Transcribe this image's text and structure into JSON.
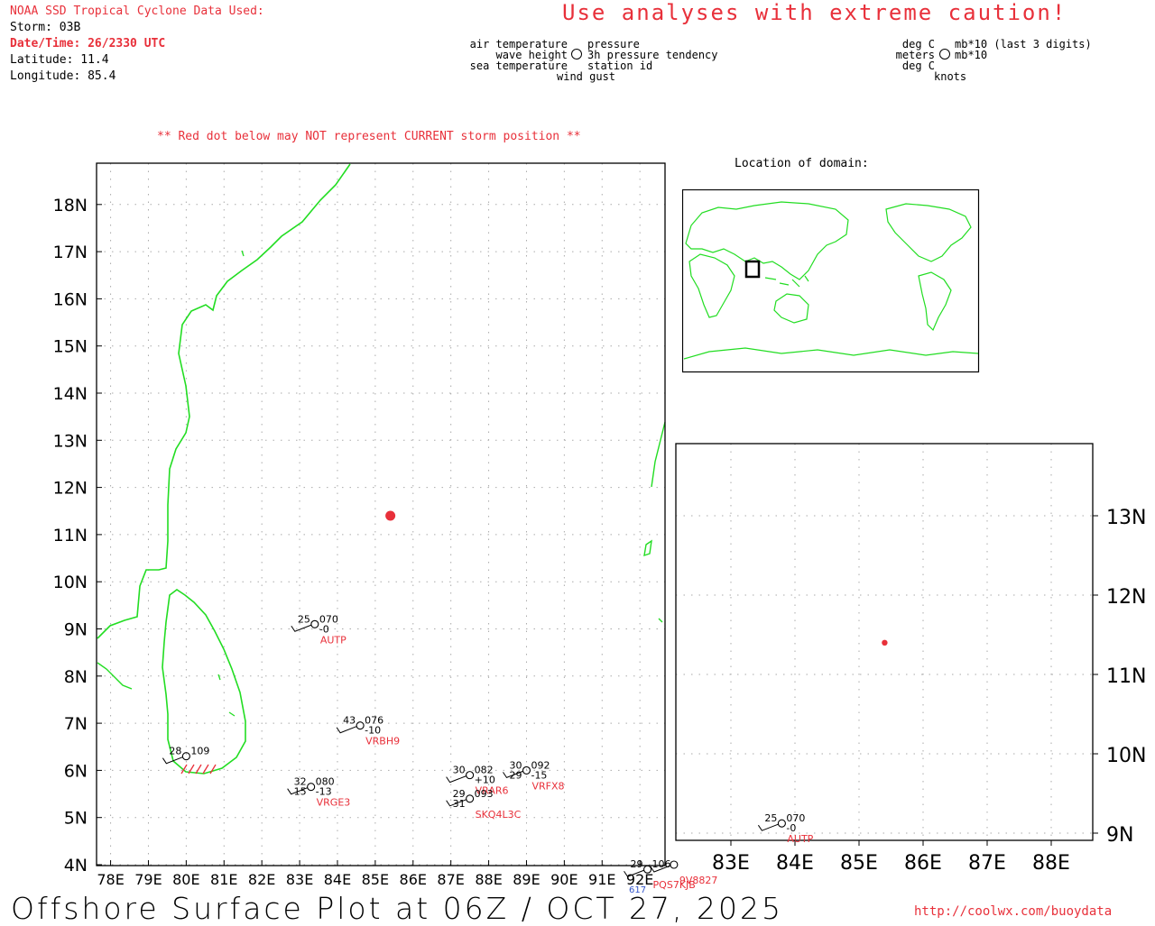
{
  "header": {
    "source": "NOAA SSD Tropical Cyclone Data Used:",
    "storm": "Storm: 03B",
    "datetime": "Date/Time: 26/2330 UTC",
    "latitude": "Latitude: 11.4",
    "longitude": "Longitude: 85.4"
  },
  "caution": "Use analyses with extreme caution!",
  "legend": {
    "left": [
      "air temperature",
      "wave height",
      "sea temperature"
    ],
    "right": [
      "pressure",
      "3h pressure tendency",
      "station id"
    ],
    "bottom": "wind gust",
    "units_left": [
      "deg C",
      "meters",
      "deg C"
    ],
    "units_right": [
      "mb*10 (last 3 digits)",
      "mb*10"
    ],
    "units_bottom": "knots"
  },
  "warning": "** Red dot below may NOT represent CURRENT storm position **",
  "location_title": "Location of domain:",
  "main_map": {
    "lat_labels": [
      "18N",
      "17N",
      "16N",
      "15N",
      "14N",
      "13N",
      "12N",
      "11N",
      "10N",
      "9N",
      "8N",
      "7N",
      "6N",
      "5N",
      "4N"
    ],
    "lon_labels": [
      "78E",
      "79E",
      "80E",
      "81E",
      "82E",
      "83E",
      "84E",
      "85E",
      "86E",
      "87E",
      "88E",
      "89E",
      "90E",
      "91E",
      "92E"
    ],
    "storm_position": {
      "lat": 11.4,
      "lon": 85.4
    },
    "stations": [
      {
        "id": "AUTP",
        "lat": 9.1,
        "lon": 83.4,
        "air": "25",
        "pressure": "070",
        "tendency": "-0"
      },
      {
        "id": "VRBH9",
        "lat": 6.95,
        "lon": 84.6,
        "air": "43",
        "pressure": "076",
        "tendency": "-10"
      },
      {
        "id": "",
        "lat": 6.3,
        "lon": 80.0,
        "air": "28",
        "pressure": "109",
        "tendency": ""
      },
      {
        "id": "VRGE3",
        "lat": 5.65,
        "lon": 83.3,
        "air": "32",
        "sea": "15",
        "pressure": "080",
        "tendency": "-13"
      },
      {
        "id": "VRAR6",
        "lat": 5.9,
        "lon": 87.5,
        "air": "30",
        "pressure": "082",
        "tendency": "+10"
      },
      {
        "id": "VRFX8",
        "lat": 6.0,
        "lon": 89.0,
        "air": "30",
        "sea": "29",
        "pressure": "092",
        "tendency": "-15"
      },
      {
        "id": "SKQ4L3C",
        "lat": 5.4,
        "lon": 87.5,
        "air": "29",
        "sea": "31",
        "pressure": "093",
        "tendency": ""
      },
      {
        "id": "PQS7KJB",
        "lat": 3.9,
        "lon": 92.2,
        "air": "29",
        "pressure": "106",
        "tendency": ""
      },
      {
        "id": "9V8827",
        "lat": 4.0,
        "lon": 92.9,
        "air": "",
        "pressure": "",
        "tendency": ""
      }
    ],
    "partial_label": "617"
  },
  "zoom_map": {
    "lat_labels": [
      "13N",
      "12N",
      "11N",
      "10N",
      "9N"
    ],
    "lon_labels": [
      "83E",
      "84E",
      "85E",
      "86E",
      "87E",
      "88E"
    ],
    "storm_position": {
      "lat": 11.4,
      "lon": 85.4
    },
    "station": {
      "id": "AUTP",
      "lat": 9.1,
      "lon": 83.4,
      "air": "25",
      "pressure": "070",
      "tendency": "-0"
    }
  },
  "footer": {
    "title": "Offshore Surface Plot at 06Z / OCT 27, 2025",
    "url": "http://coolwx.com/buoydata"
  },
  "colors": {
    "coast": "#22dd22",
    "red": "#e8303a",
    "grid": "#aaaaaa",
    "station_id": "#e8303a",
    "partial": "#3355cc"
  }
}
